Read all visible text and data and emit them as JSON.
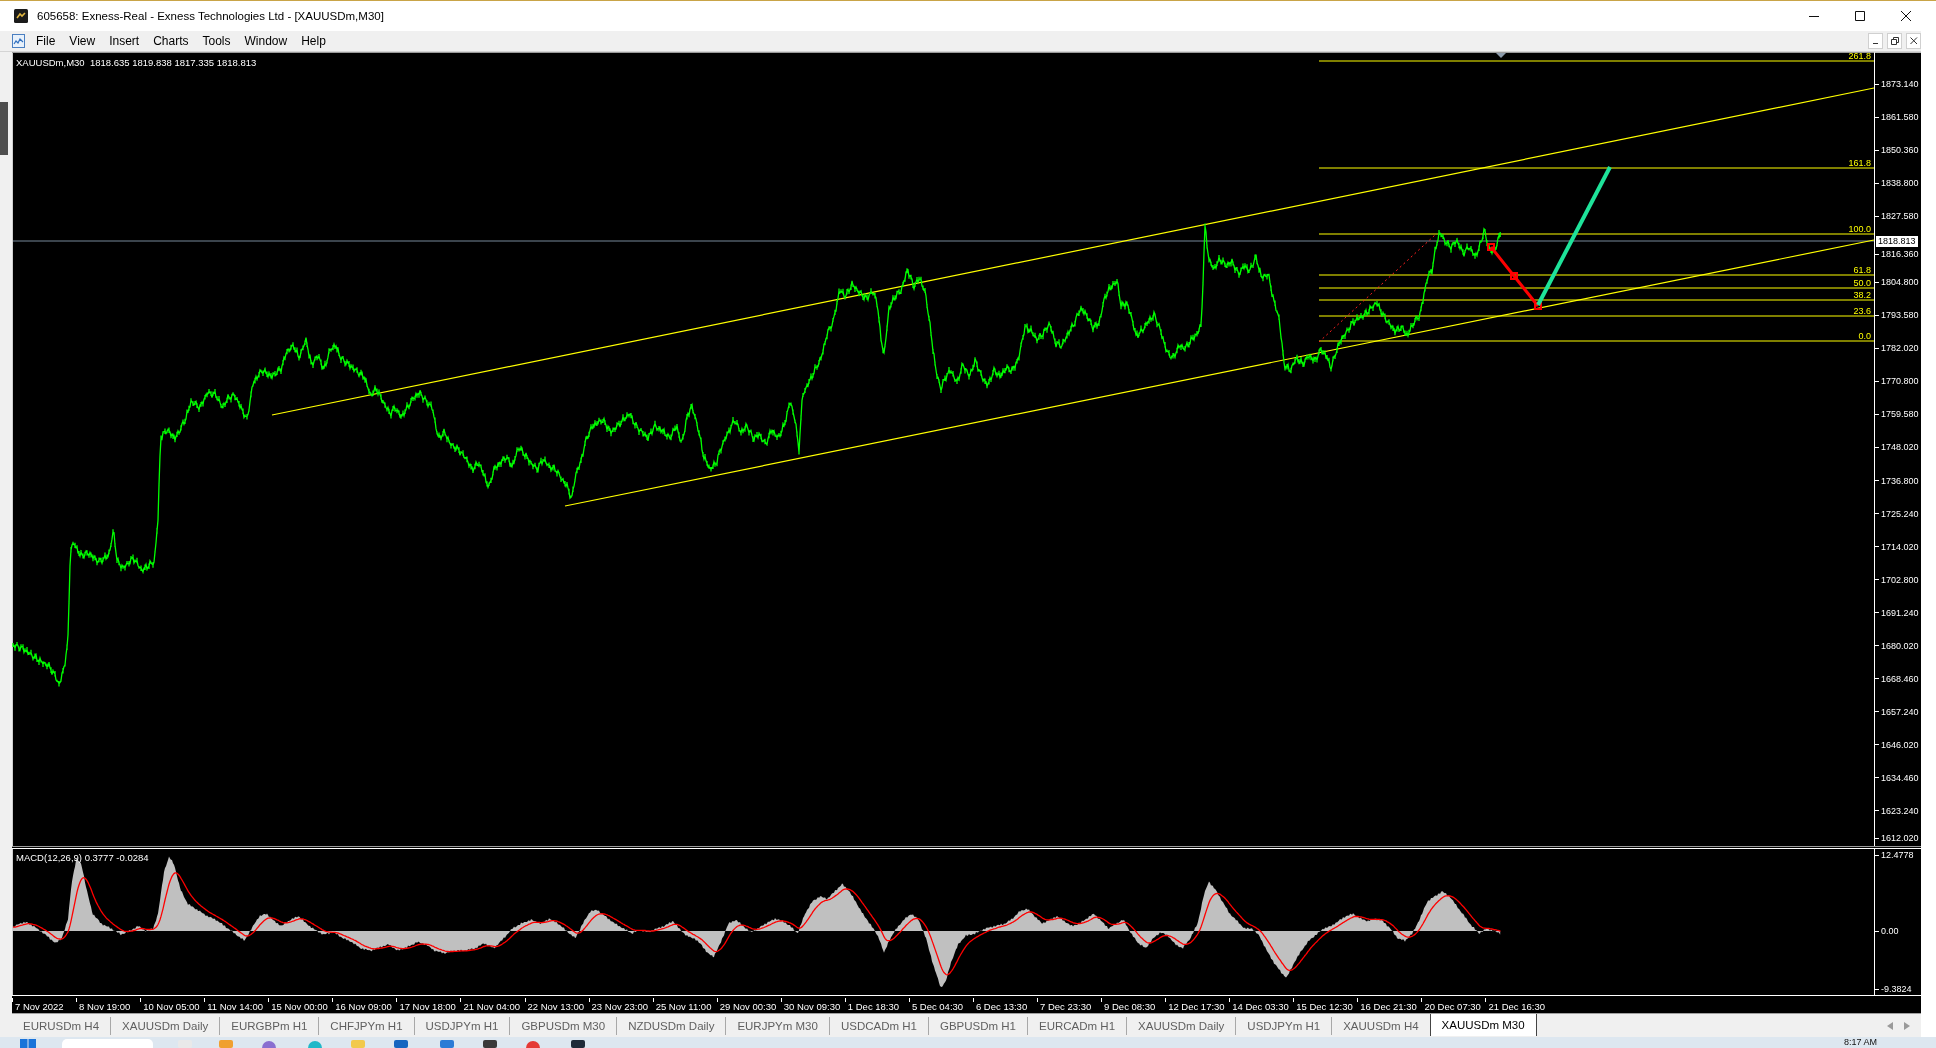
{
  "window": {
    "title": "605658: Exness-Real - Exness Technologies Ltd - [XAUUSDm,M30]"
  },
  "menu": [
    "File",
    "View",
    "Insert",
    "Charts",
    "Tools",
    "Window",
    "Help"
  ],
  "chart": {
    "header": "XAUUSDm,M30  1818.635 1819.838 1817.335 1818.813",
    "price_axis": [
      "1873.140",
      "1861.580",
      "1850.360",
      "1838.800",
      "1827.580",
      "1816.360",
      "1804.800",
      "1793.580",
      "1782.020",
      "1770.800",
      "1759.580",
      "1748.020",
      "1736.800",
      "1725.240",
      "1714.020",
      "1702.800",
      "1691.240",
      "1680.020",
      "1668.460",
      "1657.240",
      "1646.020",
      "1634.460",
      "1623.240",
      "1612.020"
    ],
    "current_price": "1818.813",
    "fibonacci_levels": [
      "261.8",
      "161.8",
      "100.0",
      "61.8",
      "50.0",
      "38.2",
      "23.6",
      "0.0"
    ],
    "macd": {
      "header": "MACD(12,26,9) 0.3777 -0.0284",
      "axis": [
        "12.4778",
        "0.00",
        "-9.3824"
      ]
    },
    "time_axis": [
      "7 Nov 2022",
      "8 Nov 19:00",
      "10 Nov 05:00",
      "11 Nov 14:00",
      "15 Nov 00:00",
      "16 Nov 09:00",
      "17 Nov 18:00",
      "21 Nov 04:00",
      "22 Nov 13:00",
      "23 Nov 23:00",
      "25 Nov 11:00",
      "29 Nov 00:30",
      "30 Nov 09:30",
      "1 Dec 18:30",
      "5 Dec 04:30",
      "6 Dec 13:30",
      "7 Dec 23:30",
      "9 Dec 08:30",
      "12 Dec 17:30",
      "14 Dec 03:30",
      "15 Dec 12:30",
      "16 Dec 21:30",
      "20 Dec 07:30",
      "21 Dec 16:30"
    ]
  },
  "tabs": [
    {
      "label": "EURUSDm H4",
      "selected": false
    },
    {
      "label": "XAUUSDm Daily",
      "selected": false
    },
    {
      "label": "EURGBPm H1",
      "selected": false
    },
    {
      "label": "CHFJPYm H1",
      "selected": false
    },
    {
      "label": "USDJPYm H1",
      "selected": false
    },
    {
      "label": "GBPUSDm M30",
      "selected": false
    },
    {
      "label": "NZDUSDm Daily",
      "selected": false
    },
    {
      "label": "EURJPYm M30",
      "selected": false
    },
    {
      "label": "USDCADm H1",
      "selected": false
    },
    {
      "label": "GBPUSDm H1",
      "selected": false
    },
    {
      "label": "EURCADm H1",
      "selected": false
    },
    {
      "label": "XAUUSDm Daily",
      "selected": false
    },
    {
      "label": "USDJPYm H1",
      "selected": false
    },
    {
      "label": "XAUUSDm H4",
      "selected": false
    },
    {
      "label": "XAUUSDm M30",
      "selected": true
    }
  ],
  "taskbar": {
    "clock": "8:17 AM"
  }
}
